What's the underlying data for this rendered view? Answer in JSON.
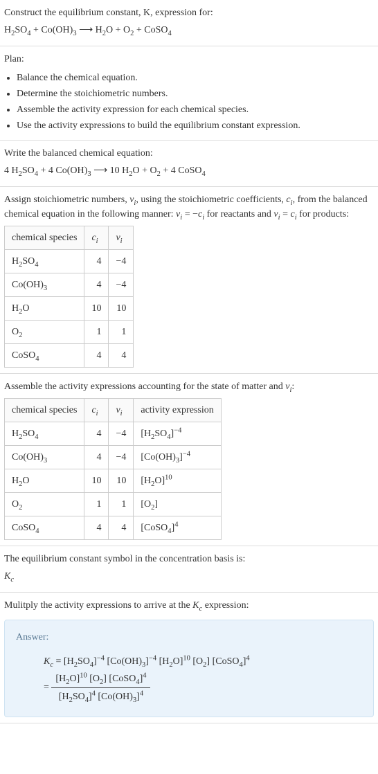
{
  "intro": {
    "prompt": "Construct the equilibrium constant, K, expression for:",
    "equation_html": "H<sub>2</sub>SO<sub>4</sub> + Co(OH)<sub>3</sub> ⟶ H<sub>2</sub>O + O<sub>2</sub> + CoSO<sub>4</sub>"
  },
  "plan": {
    "title": "Plan:",
    "items": [
      "Balance the chemical equation.",
      "Determine the stoichiometric numbers.",
      "Assemble the activity expression for each chemical species.",
      "Use the activity expressions to build the equilibrium constant expression."
    ]
  },
  "balanced": {
    "title": "Write the balanced chemical equation:",
    "equation_html": "4 H<sub>2</sub>SO<sub>4</sub> + 4 Co(OH)<sub>3</sub> ⟶ 10 H<sub>2</sub>O + O<sub>2</sub> + 4 CoSO<sub>4</sub>"
  },
  "stoich_text": {
    "line_html": "Assign stoichiometric numbers, <span class=\"ital\">ν<sub>i</sub></span>, using the stoichiometric coefficients, <span class=\"ital\">c<sub>i</sub></span>, from the balanced chemical equation in the following manner: <span class=\"ital\">ν<sub>i</sub></span> = −<span class=\"ital\">c<sub>i</sub></span> for reactants and <span class=\"ital\">ν<sub>i</sub></span> = <span class=\"ital\">c<sub>i</sub></span> for products:"
  },
  "table1": {
    "headers": {
      "species": "chemical species",
      "ci_html": "<span class=\"ital\">c<sub>i</sub></span>",
      "vi_html": "<span class=\"ital\">ν<sub>i</sub></span>"
    },
    "rows": [
      {
        "species_html": "H<sub>2</sub>SO<sub>4</sub>",
        "ci": "4",
        "vi": "−4"
      },
      {
        "species_html": "Co(OH)<sub>3</sub>",
        "ci": "4",
        "vi": "−4"
      },
      {
        "species_html": "H<sub>2</sub>O",
        "ci": "10",
        "vi": "10"
      },
      {
        "species_html": "O<sub>2</sub>",
        "ci": "1",
        "vi": "1"
      },
      {
        "species_html": "CoSO<sub>4</sub>",
        "ci": "4",
        "vi": "4"
      }
    ]
  },
  "activity_text": {
    "line_html": "Assemble the activity expressions accounting for the state of matter and <span class=\"ital\">ν<sub>i</sub></span>:"
  },
  "table2": {
    "headers": {
      "species": "chemical species",
      "ci_html": "<span class=\"ital\">c<sub>i</sub></span>",
      "vi_html": "<span class=\"ital\">ν<sub>i</sub></span>",
      "activity": "activity expression"
    },
    "rows": [
      {
        "species_html": "H<sub>2</sub>SO<sub>4</sub>",
        "ci": "4",
        "vi": "−4",
        "act_html": "[H<sub>2</sub>SO<sub>4</sub>]<sup>−4</sup>"
      },
      {
        "species_html": "Co(OH)<sub>3</sub>",
        "ci": "4",
        "vi": "−4",
        "act_html": "[Co(OH)<sub>3</sub>]<sup>−4</sup>"
      },
      {
        "species_html": "H<sub>2</sub>O",
        "ci": "10",
        "vi": "10",
        "act_html": "[H<sub>2</sub>O]<sup>10</sup>"
      },
      {
        "species_html": "O<sub>2</sub>",
        "ci": "1",
        "vi": "1",
        "act_html": "[O<sub>2</sub>]"
      },
      {
        "species_html": "CoSO<sub>4</sub>",
        "ci": "4",
        "vi": "4",
        "act_html": "[CoSO<sub>4</sub>]<sup>4</sup>"
      }
    ]
  },
  "kc_symbol": {
    "title": "The equilibrium constant symbol in the concentration basis is:",
    "symbol_html": "<span class=\"ital\">K<sub>c</sub></span>"
  },
  "multiply": {
    "line_html": "Mulitply the activity expressions to arrive at the <span class=\"ital\">K<sub>c</sub></span> expression:"
  },
  "answer": {
    "title": "Answer:",
    "line1_html": "<span class=\"ital\">K<sub>c</sub></span> = [H<sub>2</sub>SO<sub>4</sub>]<sup>−4</sup> [Co(OH)<sub>3</sub>]<sup>−4</sup> [H<sub>2</sub>O]<sup>10</sup> [O<sub>2</sub>] [CoSO<sub>4</sub>]<sup>4</sup>",
    "frac_num_html": "[H<sub>2</sub>O]<sup>10</sup> [O<sub>2</sub>] [CoSO<sub>4</sub>]<sup>4</sup>",
    "frac_den_html": "[H<sub>2</sub>SO<sub>4</sub>]<sup>4</sup> [Co(OH)<sub>3</sub>]<sup>4</sup>"
  }
}
